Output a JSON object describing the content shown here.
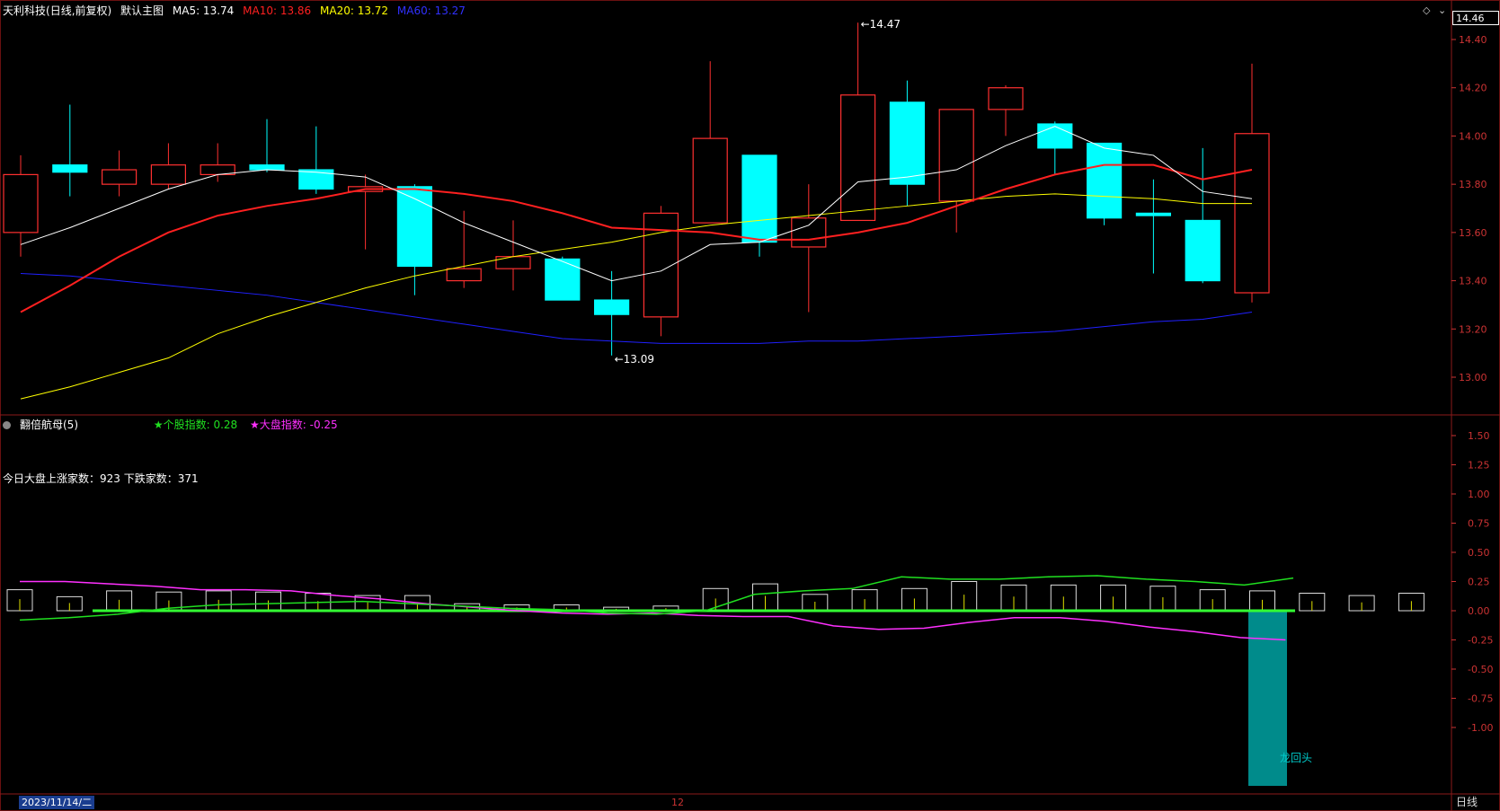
{
  "main_header": {
    "stock_name": "天利科技",
    "period_adj": "(日线,前复权)",
    "indicator_name": "默认主图",
    "ma5": "MA5: 13.74",
    "ma10": "MA10: 13.86",
    "ma20": "MA20: 13.72",
    "ma60": "MA60: 13.27"
  },
  "current_price_label": "14.46",
  "sub_header": {
    "name": "翻倍航母(5)",
    "stock_index": "★个股指数: 0.28",
    "market_index": "★大盘指数: -0.25"
  },
  "stats_line": "今日大盘上涨家数：923  下跌家数：371",
  "footer": {
    "date": "2023/11/14/二",
    "month_mark": "12",
    "period": "日线"
  },
  "colors": {
    "up": "#ff3030",
    "down": "#00ffff",
    "ma5": "#ffffff",
    "ma10": "#ff2020",
    "ma20": "#ffff00",
    "ma60": "#2020ff",
    "stock_idx": "#20e020",
    "market_idx": "#ff30ff",
    "zero_line": "#33ff33",
    "teal_bar": "#008b8b"
  },
  "chart_data": [
    {
      "type": "candlestick",
      "ylim": [
        12.9,
        14.5
      ],
      "yticks": [
        "14.40",
        "14.20",
        "14.00",
        "13.80",
        "13.60",
        "13.40",
        "13.20",
        "13.00"
      ],
      "candles": [
        {
          "o": 13.6,
          "h": 13.92,
          "l": 13.5,
          "c": 13.84
        },
        {
          "o": 13.88,
          "h": 14.13,
          "l": 13.75,
          "c": 13.85
        },
        {
          "o": 13.8,
          "h": 13.94,
          "l": 13.75,
          "c": 13.86
        },
        {
          "o": 13.8,
          "h": 13.97,
          "l": 13.78,
          "c": 13.88
        },
        {
          "o": 13.84,
          "h": 13.97,
          "l": 13.81,
          "c": 13.88
        },
        {
          "o": 13.88,
          "h": 14.07,
          "l": 13.85,
          "c": 13.86
        },
        {
          "o": 13.86,
          "h": 14.04,
          "l": 13.76,
          "c": 13.78
        },
        {
          "o": 13.77,
          "h": 13.84,
          "l": 13.53,
          "c": 13.79
        },
        {
          "o": 13.79,
          "h": 13.8,
          "l": 13.34,
          "c": 13.46
        },
        {
          "o": 13.4,
          "h": 13.69,
          "l": 13.37,
          "c": 13.45
        },
        {
          "o": 13.45,
          "h": 13.65,
          "l": 13.36,
          "c": 13.5
        },
        {
          "o": 13.49,
          "h": 13.5,
          "l": 13.32,
          "c": 13.32
        },
        {
          "o": 13.32,
          "h": 13.44,
          "l": 13.09,
          "c": 13.26
        },
        {
          "o": 13.25,
          "h": 13.71,
          "l": 13.17,
          "c": 13.68
        },
        {
          "o": 13.64,
          "h": 14.31,
          "l": 13.64,
          "c": 13.99
        },
        {
          "o": 13.92,
          "h": 13.92,
          "l": 13.5,
          "c": 13.56
        },
        {
          "o": 13.54,
          "h": 13.8,
          "l": 13.27,
          "c": 13.66
        },
        {
          "o": 13.65,
          "h": 14.47,
          "l": 13.65,
          "c": 14.17
        },
        {
          "o": 14.14,
          "h": 14.23,
          "l": 13.71,
          "c": 13.8
        },
        {
          "o": 13.73,
          "h": 14.11,
          "l": 13.6,
          "c": 14.11
        },
        {
          "o": 14.11,
          "h": 14.21,
          "l": 14.0,
          "c": 14.2
        },
        {
          "o": 14.05,
          "h": 14.06,
          "l": 13.84,
          "c": 13.95
        },
        {
          "o": 13.97,
          "h": 13.97,
          "l": 13.63,
          "c": 13.66
        },
        {
          "o": 13.68,
          "h": 13.82,
          "l": 13.43,
          "c": 13.67
        },
        {
          "o": 13.65,
          "h": 13.95,
          "l": 13.39,
          "c": 13.4
        },
        {
          "o": 13.35,
          "h": 14.3,
          "l": 13.31,
          "c": 14.01
        }
      ],
      "ma5": [
        13.55,
        13.62,
        13.7,
        13.78,
        13.84,
        13.86,
        13.85,
        13.83,
        13.74,
        13.64,
        13.56,
        13.48,
        13.4,
        13.44,
        13.55,
        13.56,
        13.63,
        13.81,
        13.83,
        13.86,
        13.96,
        14.04,
        13.95,
        13.92,
        13.77,
        13.74
      ],
      "ma10": [
        13.27,
        13.38,
        13.5,
        13.6,
        13.67,
        13.71,
        13.74,
        13.78,
        13.78,
        13.76,
        13.73,
        13.68,
        13.62,
        13.61,
        13.6,
        13.57,
        13.57,
        13.6,
        13.64,
        13.71,
        13.78,
        13.84,
        13.88,
        13.88,
        13.82,
        13.86
      ],
      "ma20": [
        12.91,
        12.96,
        13.02,
        13.08,
        13.18,
        13.25,
        13.31,
        13.37,
        13.42,
        13.46,
        13.5,
        13.53,
        13.56,
        13.6,
        13.63,
        13.65,
        13.67,
        13.69,
        13.71,
        13.73,
        13.75,
        13.76,
        13.75,
        13.74,
        13.72,
        13.72
      ],
      "ma60": [
        13.43,
        13.42,
        13.4,
        13.38,
        13.36,
        13.34,
        13.31,
        13.28,
        13.25,
        13.22,
        13.19,
        13.16,
        13.15,
        13.14,
        13.14,
        13.14,
        13.15,
        13.15,
        13.16,
        13.17,
        13.18,
        13.19,
        13.21,
        13.23,
        13.24,
        13.27
      ],
      "annotations": [
        {
          "label": "14.47",
          "index": 17,
          "value": 14.47
        },
        {
          "label": "13.09",
          "index": 12,
          "value": 13.09
        }
      ]
    },
    {
      "type": "bar",
      "title": "翻倍航母(5)",
      "ylim": [
        -1.5,
        1.5
      ],
      "yticks": [
        "1.50",
        "1.25",
        "1.00",
        "0.75",
        "0.50",
        "0.25",
        "0.00",
        "-0.25",
        "-0.50",
        "-0.75",
        "-1.00"
      ],
      "bars": [
        0.18,
        0.12,
        0.17,
        0.16,
        0.17,
        0.16,
        0.15,
        0.13,
        0.13,
        0.06,
        0.05,
        0.05,
        0.03,
        0.04,
        0.19,
        0.23,
        0.14,
        0.18,
        0.19,
        0.25,
        0.22,
        0.22,
        0.22,
        0.21,
        0.18,
        0.17,
        0.15,
        0.13,
        0.15
      ],
      "stock_index": [
        -0.08,
        -0.06,
        -0.03,
        0.02,
        0.05,
        0.06,
        0.07,
        0.08,
        0.06,
        0.04,
        0.02,
        0.01,
        -0.02,
        -0.03,
        0.0,
        0.14,
        0.17,
        0.19,
        0.29,
        0.27,
        0.27,
        0.29,
        0.3,
        0.27,
        0.25,
        0.22,
        0.28
      ],
      "market_index": [
        0.25,
        0.25,
        0.23,
        0.21,
        0.18,
        0.18,
        0.17,
        0.13,
        0.1,
        0.06,
        0.03,
        0.0,
        -0.02,
        -0.03,
        -0.02,
        -0.04,
        -0.05,
        -0.05,
        -0.13,
        -0.16,
        -0.15,
        -0.1,
        -0.06,
        -0.06,
        -0.09,
        -0.14,
        -0.18,
        -0.23,
        -0.25
      ],
      "teal_bar": {
        "index": 25,
        "value": -1.5
      },
      "annotation": "龙回头"
    }
  ]
}
